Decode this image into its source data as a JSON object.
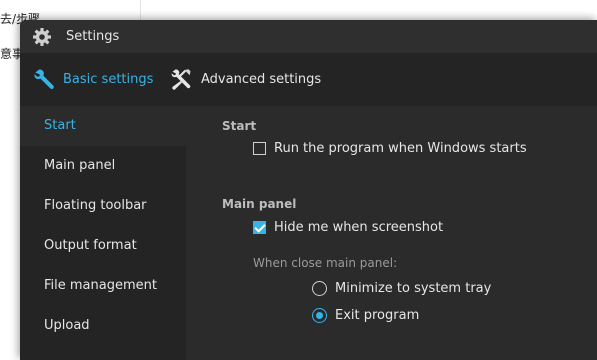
{
  "background_doc": {
    "line1": "去/步骤",
    "line2": "意事"
  },
  "window": {
    "title": "Settings",
    "icon": "gear-icon"
  },
  "tabs": [
    {
      "label": "Basic settings",
      "icon": "wrench-icon",
      "active": true
    },
    {
      "label": "Advanced settings",
      "icon": "tools-icon",
      "active": false
    }
  ],
  "sidebar": {
    "items": [
      {
        "label": "Start",
        "active": true
      },
      {
        "label": "Main panel",
        "active": false
      },
      {
        "label": "Floating toolbar",
        "active": false
      },
      {
        "label": "Output format",
        "active": false
      },
      {
        "label": "File management",
        "active": false
      },
      {
        "label": "Upload",
        "active": false
      }
    ]
  },
  "content": {
    "start": {
      "title": "Start",
      "run_on_startup": {
        "label": "Run the program when Windows starts",
        "checked": false
      }
    },
    "main_panel": {
      "title": "Main panel",
      "hide_on_screenshot": {
        "label": "Hide me when screenshot",
        "checked": true
      },
      "close_label": "When close main panel:",
      "close_options": [
        {
          "label": "Minimize to system tray",
          "selected": false
        },
        {
          "label": "Exit program",
          "selected": true
        }
      ]
    }
  },
  "colors": {
    "accent": "#37b3e6",
    "dialog_bg": "#2b2b2b",
    "sidebar_bg": "#242424",
    "text": "#e6e6e6",
    "muted": "#9a9a9a"
  }
}
